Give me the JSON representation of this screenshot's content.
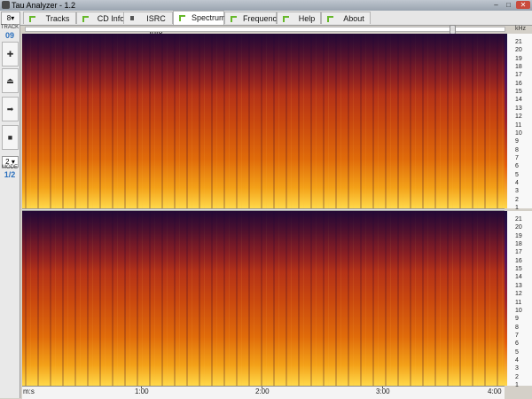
{
  "window": {
    "title": "Tau Analyzer - 1.2",
    "min": "–",
    "max": "□",
    "close": "✕"
  },
  "tabs": [
    {
      "label": "Tracks",
      "icon": "green-corner-icon"
    },
    {
      "label": "CD Info",
      "icon": "green-corner-icon"
    },
    {
      "label": "ISRC Info",
      "icon": "barcode-icon"
    },
    {
      "label": "Spectrum",
      "icon": "green-corner-icon",
      "active": true
    },
    {
      "label": "Frequency",
      "icon": "green-corner-icon"
    },
    {
      "label": "Help",
      "icon": "green-corner-icon"
    },
    {
      "label": "About",
      "icon": "green-corner-icon"
    }
  ],
  "left": {
    "selector": "8▾",
    "track_label": "TRACK",
    "track_num": "09",
    "buttons": [
      {
        "name": "add-button",
        "glyph": "✚"
      },
      {
        "name": "eject-button",
        "glyph": "⏏"
      },
      {
        "name": "next-button",
        "glyph": "➡"
      },
      {
        "name": "stop-button",
        "glyph": "■"
      }
    ],
    "mode_select": "2 ▾",
    "mode_label": "MODE",
    "mode_val": "1/2"
  },
  "spectrum": {
    "unit": "kHz",
    "ticks": [
      "21",
      "20",
      "19",
      "18",
      "17",
      "16",
      "15",
      "14",
      "13",
      "12",
      "11",
      "10",
      "9",
      "8",
      "7",
      "6",
      "5",
      "4",
      "3",
      "2",
      "1"
    ],
    "time_labels": [
      "m:s",
      "1:00",
      "2:00",
      "3:00",
      "4:00"
    ],
    "colors": {
      "low": "#1c0d3b",
      "mid": "#c8460f",
      "high": "#ffd84a"
    }
  }
}
